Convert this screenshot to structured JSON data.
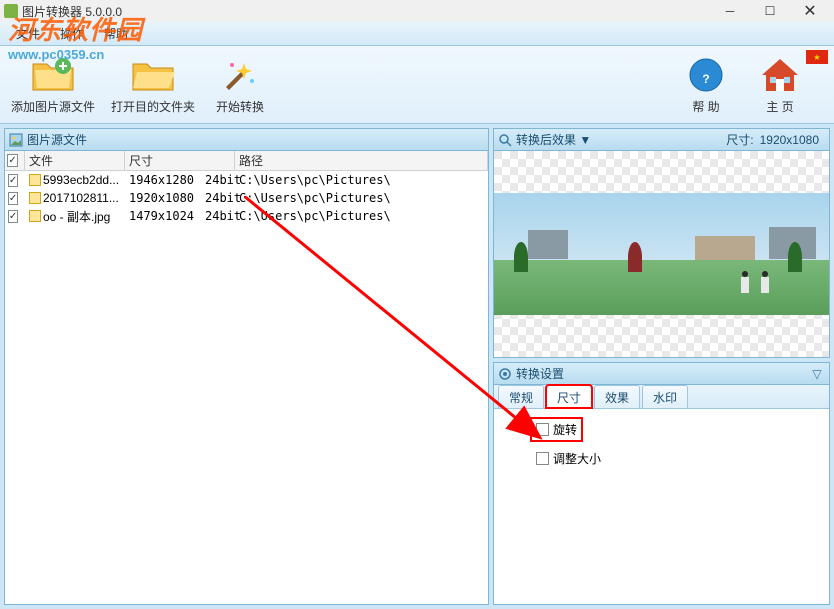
{
  "titlebar": {
    "title": "图片转换器 5.0.0.0"
  },
  "watermark": {
    "title": "河东软件园",
    "url": "www.pc0359.cn"
  },
  "menu": {
    "file": "文件",
    "operation": "操作",
    "help": "帮助"
  },
  "toolbar": {
    "add_source": "添加图片源文件",
    "open_dest": "打开目的文件夹",
    "convert": "开始转换",
    "help": "帮 助",
    "home": "主 页"
  },
  "panels": {
    "source_files": "图片源文件",
    "preview": "转换后效果",
    "preview_dropdown": "▼",
    "preview_size_label": "尺寸:",
    "preview_size_value": "1920x1080",
    "settings": "转换设置"
  },
  "table": {
    "headers": {
      "file": "文件",
      "size": "尺寸",
      "path": "路径"
    },
    "rows": [
      {
        "checked": true,
        "name": "5993ecb2dd...",
        "dim": "1946x1280",
        "bit": "24bit",
        "path": "C:\\Users\\pc\\Pictures\\"
      },
      {
        "checked": true,
        "name": "2017102811...",
        "dim": "1920x1080",
        "bit": "24bit",
        "path": "C:\\Users\\pc\\Pictures\\"
      },
      {
        "checked": true,
        "name": "oo - 副本.jpg",
        "dim": "1479x1024",
        "bit": "24bit",
        "path": "C:\\Users\\pc\\Pictures\\"
      }
    ]
  },
  "tabs": {
    "general": "常规",
    "size": "尺寸",
    "effect": "效果",
    "watermark": "水印"
  },
  "settings": {
    "rotate": "旋转",
    "resize": "调整大小"
  }
}
